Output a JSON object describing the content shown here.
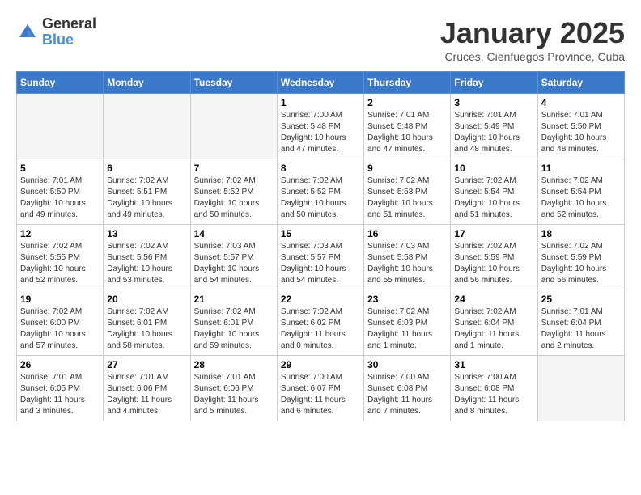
{
  "header": {
    "logo_general": "General",
    "logo_blue": "Blue",
    "month_title": "January 2025",
    "subtitle": "Cruces, Cienfuegos Province, Cuba"
  },
  "days_of_week": [
    "Sunday",
    "Monday",
    "Tuesday",
    "Wednesday",
    "Thursday",
    "Friday",
    "Saturday"
  ],
  "weeks": [
    [
      {
        "day": "",
        "info": ""
      },
      {
        "day": "",
        "info": ""
      },
      {
        "day": "",
        "info": ""
      },
      {
        "day": "1",
        "info": "Sunrise: 7:00 AM\nSunset: 5:48 PM\nDaylight: 10 hours\nand 47 minutes."
      },
      {
        "day": "2",
        "info": "Sunrise: 7:01 AM\nSunset: 5:48 PM\nDaylight: 10 hours\nand 47 minutes."
      },
      {
        "day": "3",
        "info": "Sunrise: 7:01 AM\nSunset: 5:49 PM\nDaylight: 10 hours\nand 48 minutes."
      },
      {
        "day": "4",
        "info": "Sunrise: 7:01 AM\nSunset: 5:50 PM\nDaylight: 10 hours\nand 48 minutes."
      }
    ],
    [
      {
        "day": "5",
        "info": "Sunrise: 7:01 AM\nSunset: 5:50 PM\nDaylight: 10 hours\nand 49 minutes."
      },
      {
        "day": "6",
        "info": "Sunrise: 7:02 AM\nSunset: 5:51 PM\nDaylight: 10 hours\nand 49 minutes."
      },
      {
        "day": "7",
        "info": "Sunrise: 7:02 AM\nSunset: 5:52 PM\nDaylight: 10 hours\nand 50 minutes."
      },
      {
        "day": "8",
        "info": "Sunrise: 7:02 AM\nSunset: 5:52 PM\nDaylight: 10 hours\nand 50 minutes."
      },
      {
        "day": "9",
        "info": "Sunrise: 7:02 AM\nSunset: 5:53 PM\nDaylight: 10 hours\nand 51 minutes."
      },
      {
        "day": "10",
        "info": "Sunrise: 7:02 AM\nSunset: 5:54 PM\nDaylight: 10 hours\nand 51 minutes."
      },
      {
        "day": "11",
        "info": "Sunrise: 7:02 AM\nSunset: 5:54 PM\nDaylight: 10 hours\nand 52 minutes."
      }
    ],
    [
      {
        "day": "12",
        "info": "Sunrise: 7:02 AM\nSunset: 5:55 PM\nDaylight: 10 hours\nand 52 minutes."
      },
      {
        "day": "13",
        "info": "Sunrise: 7:02 AM\nSunset: 5:56 PM\nDaylight: 10 hours\nand 53 minutes."
      },
      {
        "day": "14",
        "info": "Sunrise: 7:03 AM\nSunset: 5:57 PM\nDaylight: 10 hours\nand 54 minutes."
      },
      {
        "day": "15",
        "info": "Sunrise: 7:03 AM\nSunset: 5:57 PM\nDaylight: 10 hours\nand 54 minutes."
      },
      {
        "day": "16",
        "info": "Sunrise: 7:03 AM\nSunset: 5:58 PM\nDaylight: 10 hours\nand 55 minutes."
      },
      {
        "day": "17",
        "info": "Sunrise: 7:02 AM\nSunset: 5:59 PM\nDaylight: 10 hours\nand 56 minutes."
      },
      {
        "day": "18",
        "info": "Sunrise: 7:02 AM\nSunset: 5:59 PM\nDaylight: 10 hours\nand 56 minutes."
      }
    ],
    [
      {
        "day": "19",
        "info": "Sunrise: 7:02 AM\nSunset: 6:00 PM\nDaylight: 10 hours\nand 57 minutes."
      },
      {
        "day": "20",
        "info": "Sunrise: 7:02 AM\nSunset: 6:01 PM\nDaylight: 10 hours\nand 58 minutes."
      },
      {
        "day": "21",
        "info": "Sunrise: 7:02 AM\nSunset: 6:01 PM\nDaylight: 10 hours\nand 59 minutes."
      },
      {
        "day": "22",
        "info": "Sunrise: 7:02 AM\nSunset: 6:02 PM\nDaylight: 11 hours\nand 0 minutes."
      },
      {
        "day": "23",
        "info": "Sunrise: 7:02 AM\nSunset: 6:03 PM\nDaylight: 11 hours\nand 1 minute."
      },
      {
        "day": "24",
        "info": "Sunrise: 7:02 AM\nSunset: 6:04 PM\nDaylight: 11 hours\nand 1 minute."
      },
      {
        "day": "25",
        "info": "Sunrise: 7:01 AM\nSunset: 6:04 PM\nDaylight: 11 hours\nand 2 minutes."
      }
    ],
    [
      {
        "day": "26",
        "info": "Sunrise: 7:01 AM\nSunset: 6:05 PM\nDaylight: 11 hours\nand 3 minutes."
      },
      {
        "day": "27",
        "info": "Sunrise: 7:01 AM\nSunset: 6:06 PM\nDaylight: 11 hours\nand 4 minutes."
      },
      {
        "day": "28",
        "info": "Sunrise: 7:01 AM\nSunset: 6:06 PM\nDaylight: 11 hours\nand 5 minutes."
      },
      {
        "day": "29",
        "info": "Sunrise: 7:00 AM\nSunset: 6:07 PM\nDaylight: 11 hours\nand 6 minutes."
      },
      {
        "day": "30",
        "info": "Sunrise: 7:00 AM\nSunset: 6:08 PM\nDaylight: 11 hours\nand 7 minutes."
      },
      {
        "day": "31",
        "info": "Sunrise: 7:00 AM\nSunset: 6:08 PM\nDaylight: 11 hours\nand 8 minutes."
      },
      {
        "day": "",
        "info": ""
      }
    ]
  ]
}
